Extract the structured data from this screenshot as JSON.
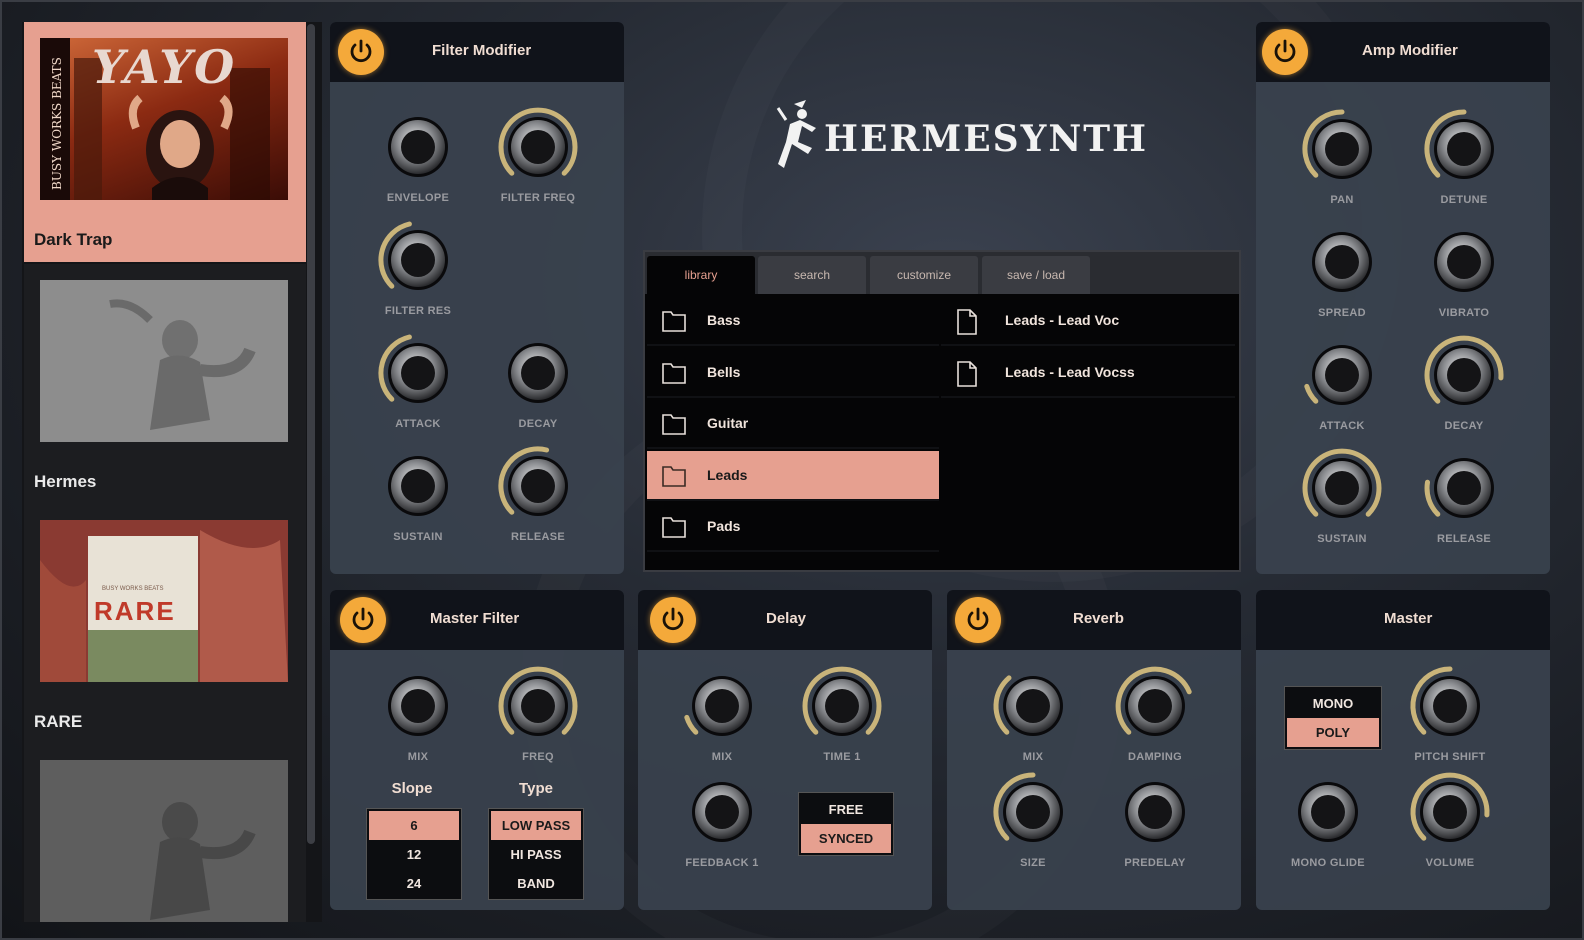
{
  "app": {
    "logo_text": "HERMESYNTH"
  },
  "presets": [
    {
      "name": "Dark Trap",
      "active": true
    },
    {
      "name": "Hermes",
      "active": false
    },
    {
      "name": "RARE",
      "active": false
    },
    {
      "name": "",
      "active": false
    }
  ],
  "cover_text": {
    "art1_title": "YAYO",
    "art1_spine": "BUSY WORKS BEATS",
    "art3_title": "RARE",
    "art3_sub": "BUSY WORKS BEATS"
  },
  "filter_modifier": {
    "title": "Filter Modifier",
    "knobs": [
      {
        "label": "ENVELOPE",
        "value": 0.0
      },
      {
        "label": "FILTER FREQ",
        "value": 1.0
      },
      {
        "label": "FILTER RES",
        "value": 0.45
      },
      {
        "label": "ATTACK",
        "value": 0.45
      },
      {
        "label": "DECAY",
        "value": 0.0
      },
      {
        "label": "SUSTAIN",
        "value": 0.0
      },
      {
        "label": "RELEASE",
        "value": 0.55
      }
    ]
  },
  "amp_modifier": {
    "title": "Amp Modifier",
    "knobs": [
      {
        "label": "PAN",
        "value": 0.5
      },
      {
        "label": "DETUNE",
        "value": 0.5
      },
      {
        "label": "SPREAD",
        "value": 0.0
      },
      {
        "label": "VIBRATO",
        "value": 0.0
      },
      {
        "label": "ATTACK",
        "value": 0.1
      },
      {
        "label": "DECAY",
        "value": 0.85
      },
      {
        "label": "SUSTAIN",
        "value": 1.0
      },
      {
        "label": "RELEASE",
        "value": 0.2
      }
    ]
  },
  "browser": {
    "tabs": [
      "library",
      "search",
      "customize",
      "save / load"
    ],
    "active_tab": 0,
    "folders": [
      "Bass",
      "Bells",
      "Guitar",
      "Leads",
      "Pads"
    ],
    "selected_folder": 3,
    "files": [
      "Leads - Lead Voc",
      "Leads - Lead Vocss"
    ]
  },
  "master_filter": {
    "title": "Master Filter",
    "knobs": [
      {
        "label": "MIX",
        "value": 0.0
      },
      {
        "label": "FREQ",
        "value": 1.0
      }
    ],
    "slope": {
      "title": "Slope",
      "options": [
        "6",
        "12",
        "24"
      ],
      "selected": 0
    },
    "type": {
      "title": "Type",
      "options": [
        "LOW PASS",
        "HI PASS",
        "BAND"
      ],
      "selected": 0
    }
  },
  "delay": {
    "title": "Delay",
    "knobs": [
      {
        "label": "MIX",
        "value": 0.1
      },
      {
        "label": "TIME 1",
        "value": 1.0
      },
      {
        "label": "FEEDBACK 1",
        "value": 0.0
      }
    ],
    "mode": {
      "options": [
        "FREE",
        "SYNCED"
      ],
      "selected": 1
    }
  },
  "reverb": {
    "title": "Reverb",
    "knobs": [
      {
        "label": "MIX",
        "value": 0.35
      },
      {
        "label": "DAMPING",
        "value": 0.75
      },
      {
        "label": "SIZE",
        "value": 0.5
      },
      {
        "label": "PREDELAY",
        "value": 0.0
      }
    ]
  },
  "master": {
    "title": "Master",
    "voice": {
      "options": [
        "MONO",
        "POLY"
      ],
      "selected": 1
    },
    "knobs": [
      {
        "label": "PITCH SHIFT",
        "value": 0.5
      },
      {
        "label": "MONO GLIDE",
        "value": 0.0
      },
      {
        "label": "VOLUME",
        "value": 0.85
      }
    ]
  },
  "colors": {
    "accent": "#e6a090",
    "power": "#f4a93a",
    "knob_arc": "#c9b47a",
    "panel": "#3a424e",
    "header": "#10131a"
  }
}
